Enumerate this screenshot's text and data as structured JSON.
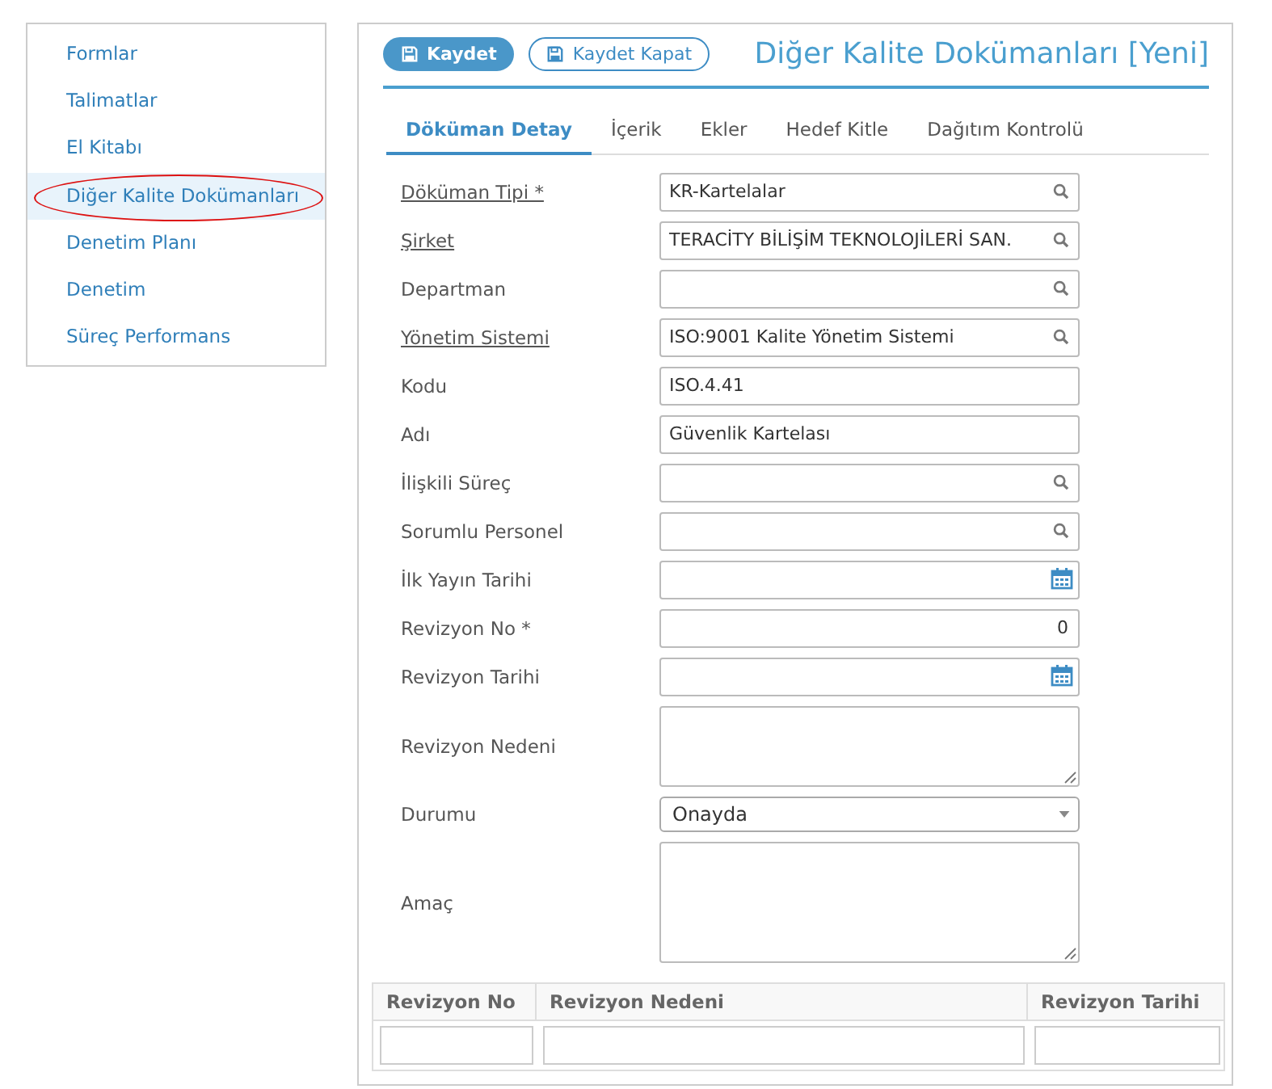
{
  "sidebar": {
    "items": [
      {
        "label": "Formlar",
        "selected": false,
        "circled": false
      },
      {
        "label": "Talimatlar",
        "selected": false,
        "circled": false
      },
      {
        "label": "El Kitabı",
        "selected": false,
        "circled": false
      },
      {
        "label": "Diğer Kalite Dokümanları",
        "selected": true,
        "circled": true
      },
      {
        "label": "Denetim Planı",
        "selected": false,
        "circled": false
      },
      {
        "label": "Denetim",
        "selected": false,
        "circled": false
      },
      {
        "label": "Süreç Performans",
        "selected": false,
        "circled": false
      }
    ]
  },
  "toolbar": {
    "buttons": [
      {
        "label": "Kaydet",
        "kind": "primary"
      },
      {
        "label": "Kaydet Kapat",
        "kind": "outline"
      }
    ]
  },
  "page_title": "Diğer Kalite Dokümanları [Yeni]",
  "tabs": [
    {
      "label": "Döküman Detay",
      "selected": true
    },
    {
      "label": "İçerik",
      "selected": false
    },
    {
      "label": "Ekler",
      "selected": false
    },
    {
      "label": "Hedef Kitle",
      "selected": false
    },
    {
      "label": "Dağıtım Kontrolü",
      "selected": false
    }
  ],
  "fields": [
    {
      "label": "Döküman Tipi *",
      "linked": true,
      "kind": "lookup",
      "value": "KR-Kartelalar"
    },
    {
      "label": "Şirket",
      "linked": true,
      "kind": "lookup",
      "value": "TERACİTY BİLİŞİM TEKNOLOJİLERİ SAN."
    },
    {
      "label": "Departman",
      "linked": false,
      "kind": "lookup"
    },
    {
      "label": "Yönetim Sistemi",
      "linked": true,
      "kind": "lookup",
      "value": "ISO:9001 Kalite Yönetim Sistemi"
    },
    {
      "label": "Kodu",
      "linked": false,
      "kind": "text",
      "value": "ISO.4.41"
    },
    {
      "label": "Adı",
      "linked": false,
      "kind": "text",
      "value": "Güvenlik Kartelası"
    },
    {
      "label": "İlişkili Süreç",
      "linked": false,
      "kind": "lookup"
    },
    {
      "label": "Sorumlu Personel",
      "linked": false,
      "kind": "lookup"
    },
    {
      "label": "İlk Yayın Tarihi",
      "linked": false,
      "kind": "date"
    },
    {
      "label": "Revizyon No *",
      "linked": false,
      "kind": "number",
      "value": "0"
    },
    {
      "label": "Revizyon Tarihi",
      "linked": false,
      "kind": "date"
    },
    {
      "label": "Revizyon Nedeni",
      "linked": false,
      "kind": "textarea"
    },
    {
      "label": "Durumu",
      "linked": false,
      "kind": "select",
      "value": "Onayda"
    },
    {
      "label": "Amaç",
      "linked": false,
      "kind": "textarea_large"
    }
  ],
  "revision_table": {
    "columns": [
      "Revizyon No",
      "Revizyon Nedeni",
      "Revizyon Tarihi"
    ]
  }
}
